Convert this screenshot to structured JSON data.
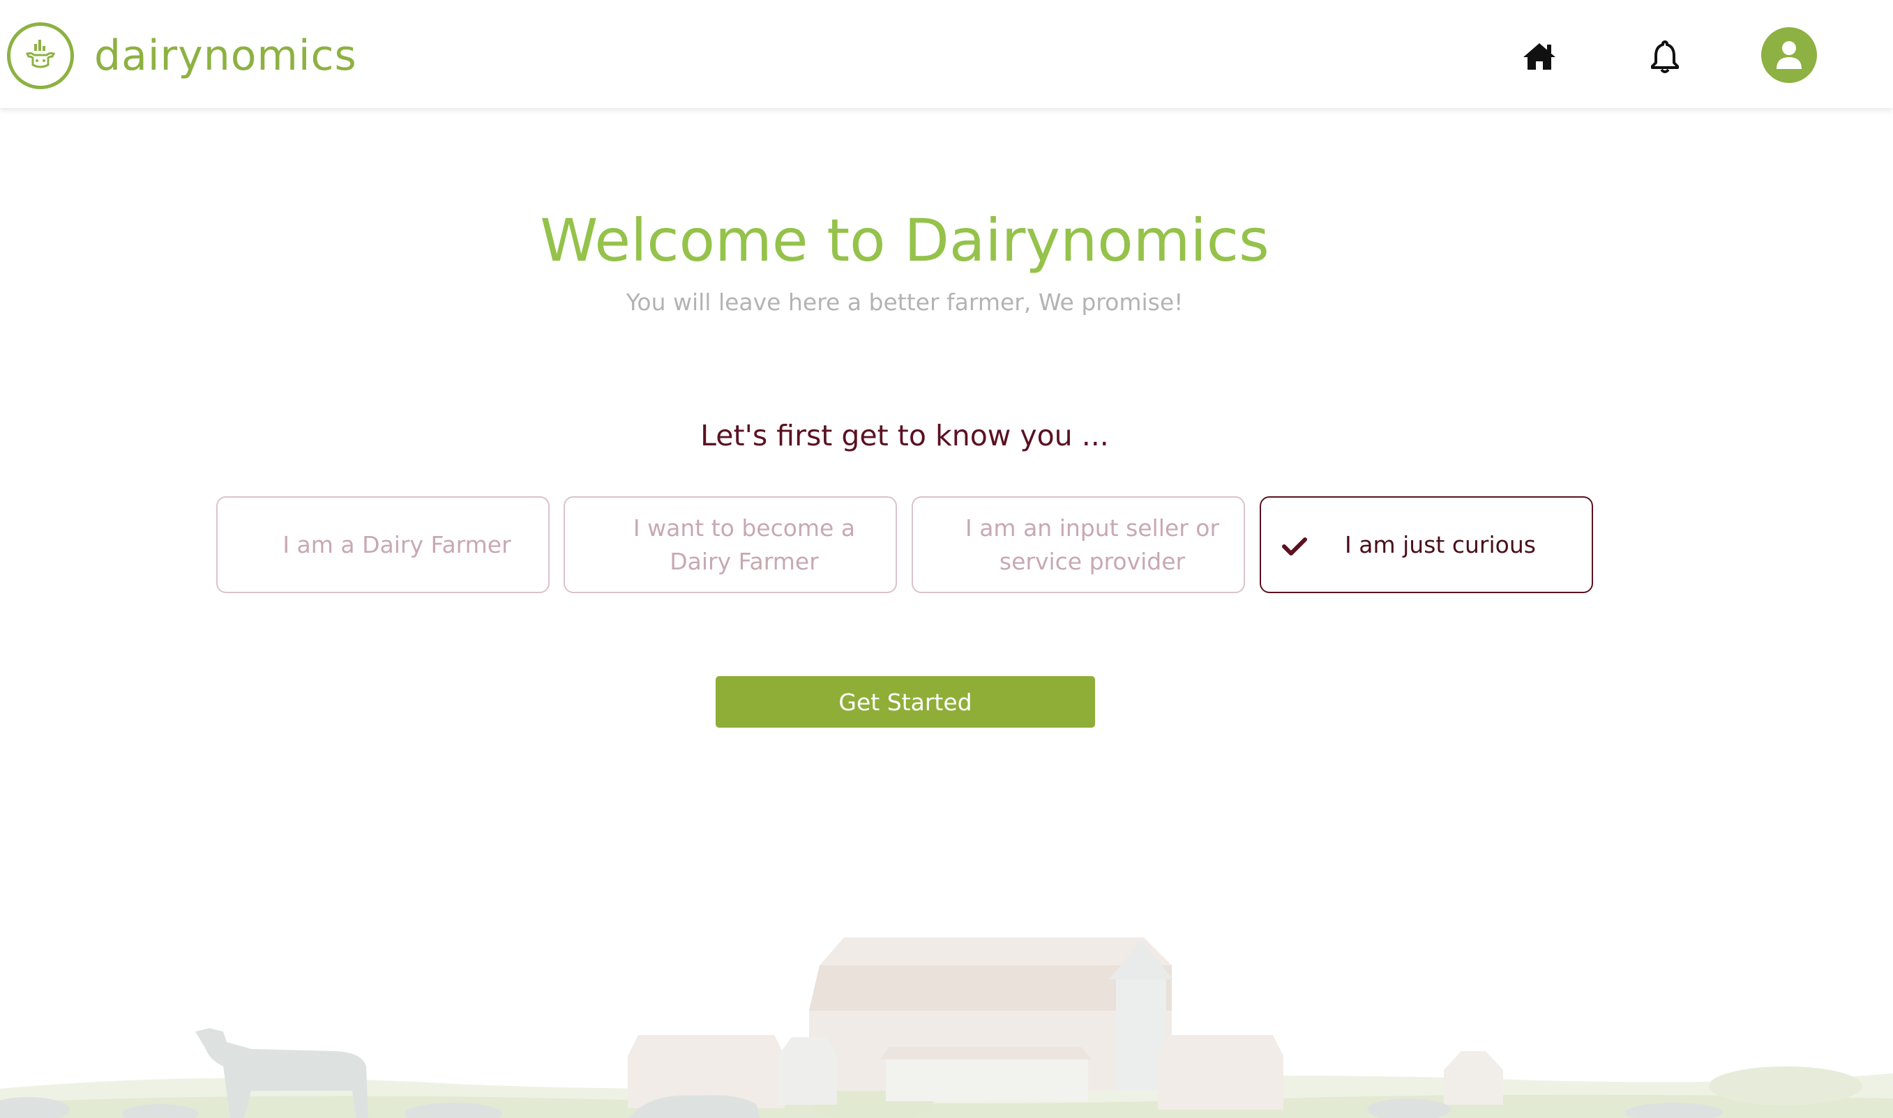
{
  "header": {
    "brand": "dairynomics",
    "icons": {
      "logo": "dairynomics-logo-icon",
      "home": "home-icon",
      "notifications": "bell-icon",
      "profile": "user-avatar-icon"
    }
  },
  "main": {
    "title": "Welcome to Dairynomics",
    "subtitle": "You will leave here a better farmer, We promise!",
    "question": "Let's first get to know you ...",
    "options": [
      {
        "label": "I am a Dairy Farmer",
        "selected": false
      },
      {
        "label": "I want to become a Dairy Farmer",
        "selected": false
      },
      {
        "label": "I am an input seller or service provider",
        "selected": false
      },
      {
        "label": "I am just curious",
        "selected": true
      }
    ],
    "cta_label": "Get Started"
  },
  "colors": {
    "brand_green": "#8db142",
    "title_green": "#94c24a",
    "button_green": "#8fae38",
    "maroon": "#5a1222",
    "muted_text": "#b3b3b3",
    "unselected_option_text": "#c7a9b1"
  }
}
